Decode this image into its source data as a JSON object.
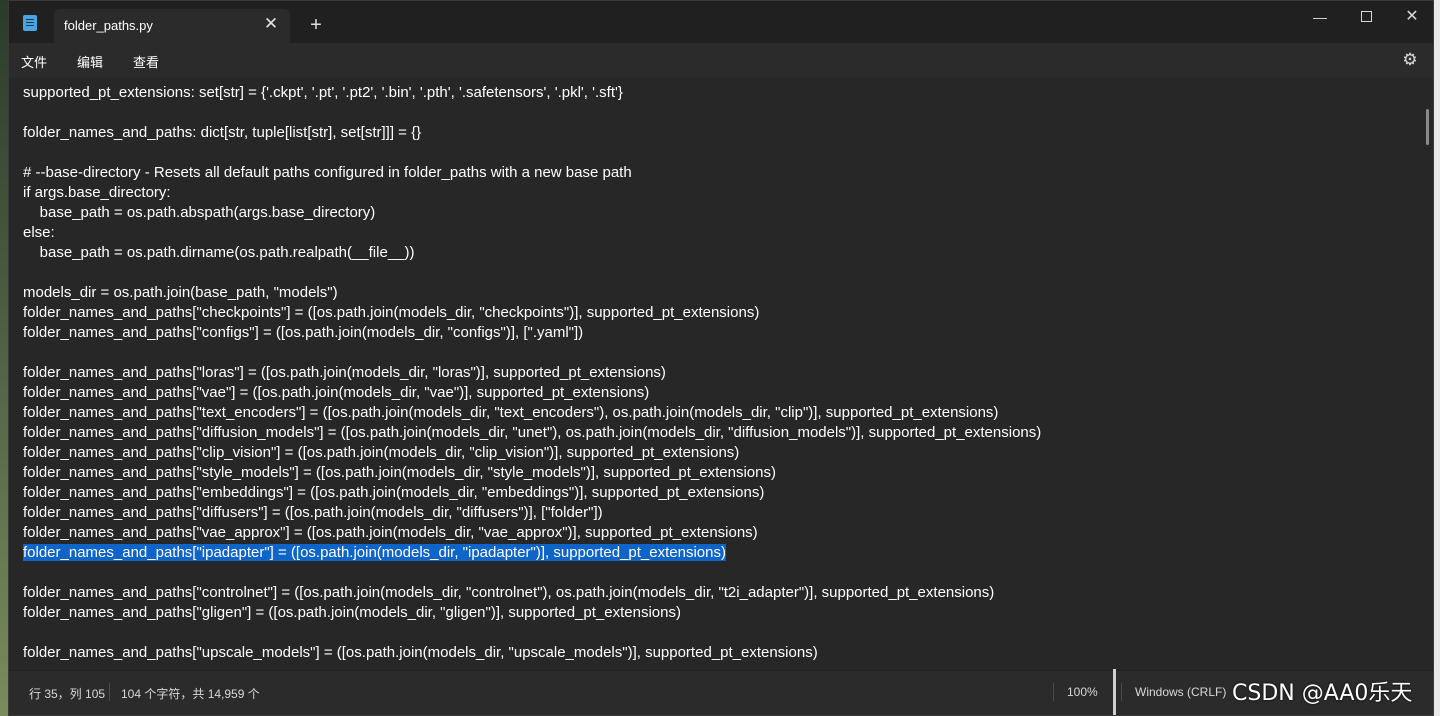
{
  "window": {
    "tab_title": "folder_paths.py",
    "tab_close": "✕",
    "tab_new": "+",
    "min": "—",
    "close": "✕"
  },
  "menu": {
    "file": "文件",
    "edit": "编辑",
    "view": "查看",
    "settings_icon": "gear-icon"
  },
  "editor": {
    "lines": [
      "supported_pt_extensions: set[str] = {'.ckpt', '.pt', '.pt2', '.bin', '.pth', '.safetensors', '.pkl', '.sft'}",
      "",
      "folder_names_and_paths: dict[str, tuple[list[str], set[str]]] = {}",
      "",
      "# --base-directory - Resets all default paths configured in folder_paths with a new base path",
      "if args.base_directory:",
      "    base_path = os.path.abspath(args.base_directory)",
      "else:",
      "    base_path = os.path.dirname(os.path.realpath(__file__))",
      "",
      "models_dir = os.path.join(base_path, \"models\")",
      "folder_names_and_paths[\"checkpoints\"] = ([os.path.join(models_dir, \"checkpoints\")], supported_pt_extensions)",
      "folder_names_and_paths[\"configs\"] = ([os.path.join(models_dir, \"configs\")], [\".yaml\"])",
      "",
      "folder_names_and_paths[\"loras\"] = ([os.path.join(models_dir, \"loras\")], supported_pt_extensions)",
      "folder_names_and_paths[\"vae\"] = ([os.path.join(models_dir, \"vae\")], supported_pt_extensions)",
      "folder_names_and_paths[\"text_encoders\"] = ([os.path.join(models_dir, \"text_encoders\"), os.path.join(models_dir, \"clip\")], supported_pt_extensions)",
      "folder_names_and_paths[\"diffusion_models\"] = ([os.path.join(models_dir, \"unet\"), os.path.join(models_dir, \"diffusion_models\")], supported_pt_extensions)",
      "folder_names_and_paths[\"clip_vision\"] = ([os.path.join(models_dir, \"clip_vision\")], supported_pt_extensions)",
      "folder_names_and_paths[\"style_models\"] = ([os.path.join(models_dir, \"style_models\")], supported_pt_extensions)",
      "folder_names_and_paths[\"embeddings\"] = ([os.path.join(models_dir, \"embeddings\")], supported_pt_extensions)",
      "folder_names_and_paths[\"diffusers\"] = ([os.path.join(models_dir, \"diffusers\")], [\"folder\"])",
      "folder_names_and_paths[\"vae_approx\"] = ([os.path.join(models_dir, \"vae_approx\")], supported_pt_extensions)",
      "folder_names_and_paths[\"ipadapter\"] = ([os.path.join(models_dir, \"ipadapter\")], supported_pt_extensions)",
      "",
      "folder_names_and_paths[\"controlnet\"] = ([os.path.join(models_dir, \"controlnet\"), os.path.join(models_dir, \"t2i_adapter\")], supported_pt_extensions)",
      "folder_names_and_paths[\"gligen\"] = ([os.path.join(models_dir, \"gligen\")], supported_pt_extensions)",
      "",
      "folder_names_and_paths[\"upscale_models\"] = ([os.path.join(models_dir, \"upscale_models\")], supported_pt_extensions)"
    ],
    "selected_line": 23
  },
  "status": {
    "position": "行 35，列 105",
    "chars": "104 个字符，共 14,959 个",
    "zoom": "100%",
    "line_ending": "Windows (CRLF)"
  },
  "watermark": "CSDN @AA0乐天"
}
